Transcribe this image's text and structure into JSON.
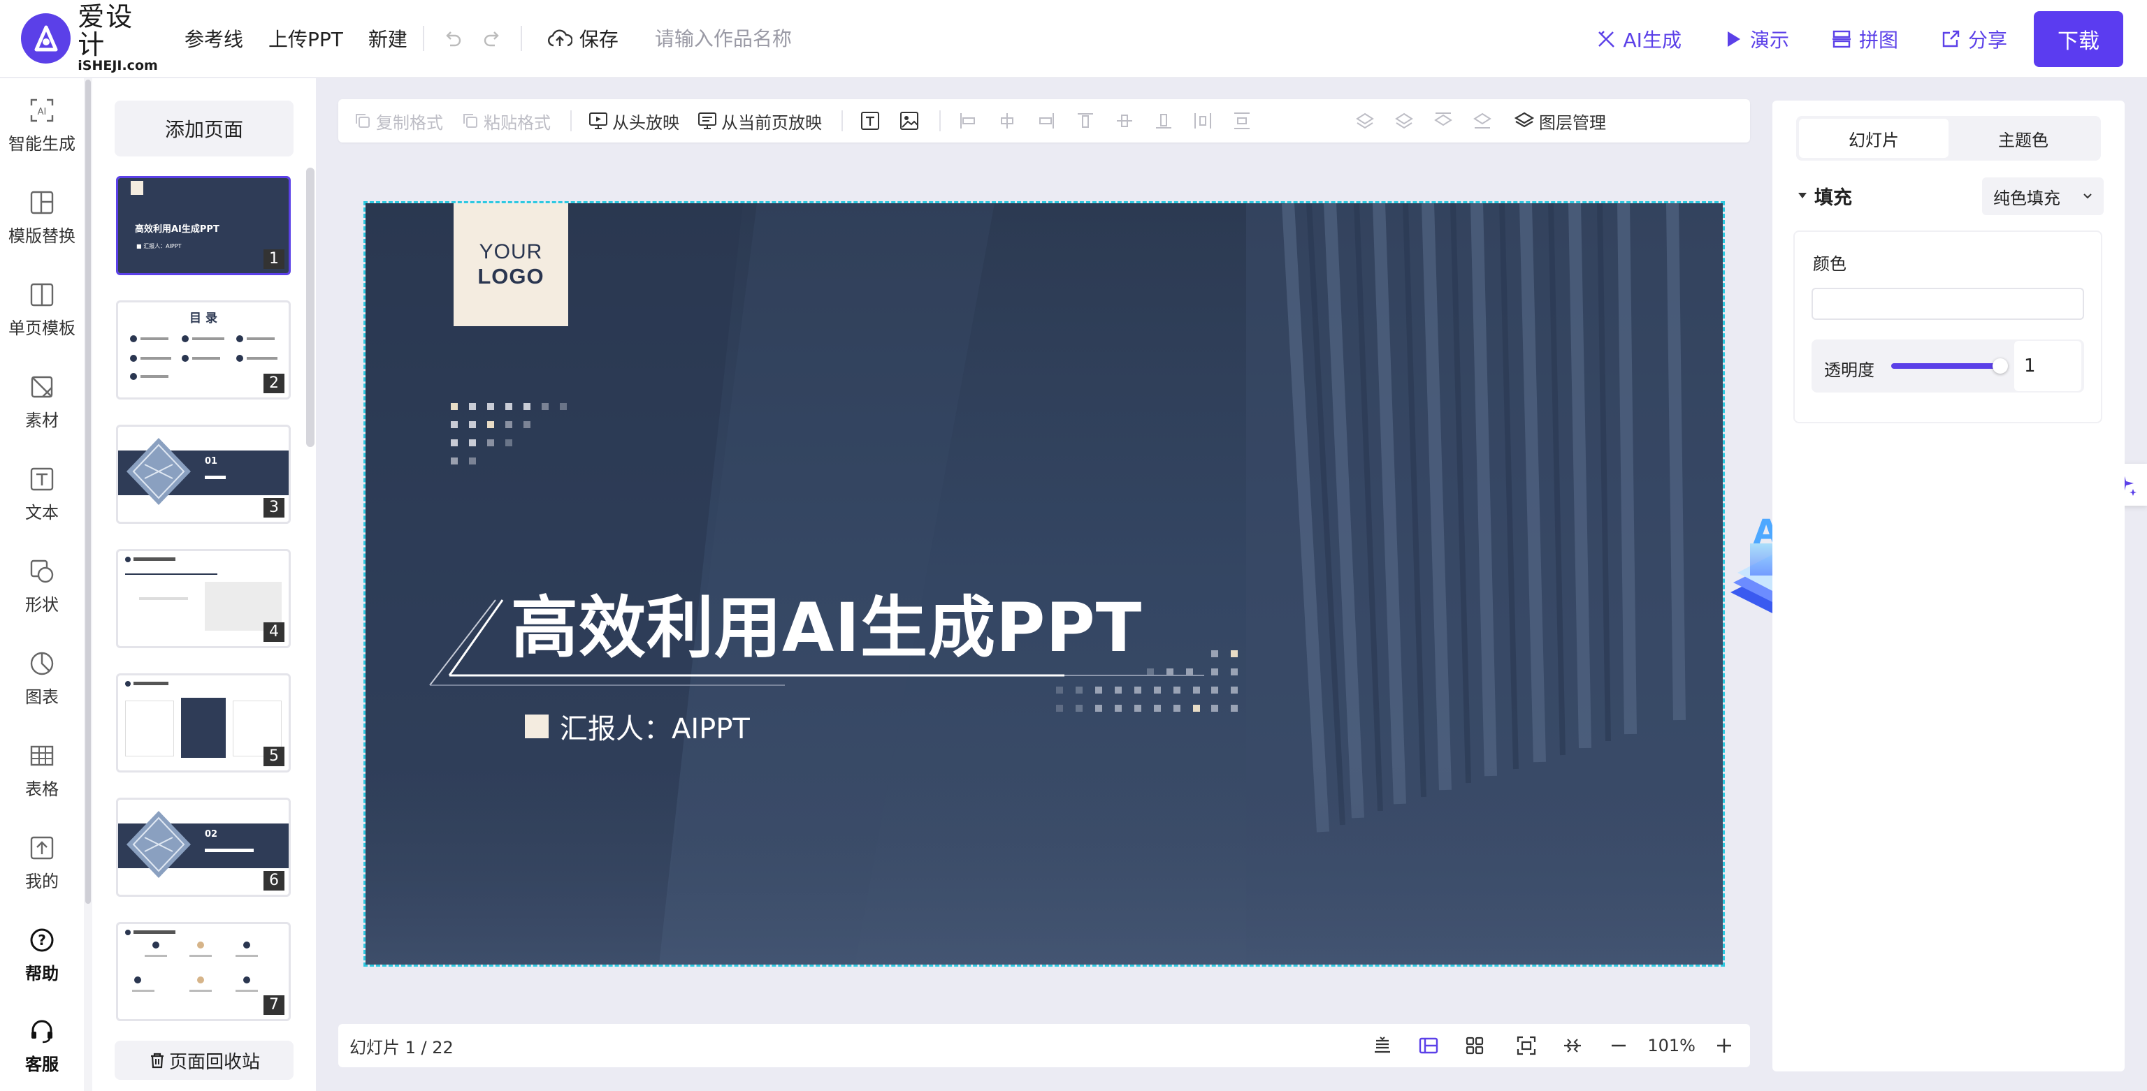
{
  "header": {
    "logo_cn": "爱设计",
    "logo_en": "iSHEJI.com",
    "menu": [
      "参考线",
      "上传PPT",
      "新建"
    ],
    "save_label": "保存",
    "title_placeholder": "请输入作品名称",
    "actions": {
      "ai_generate": "AI生成",
      "present": "演示",
      "collage": "拼图",
      "share": "分享"
    },
    "download_label": "下载",
    "accent_color": "#5b40e8"
  },
  "left_tools": [
    {
      "label": "智能生成",
      "icon": "ai-generate-icon"
    },
    {
      "label": "模版替换",
      "icon": "template-replace-icon"
    },
    {
      "label": "单页模板",
      "icon": "single-page-template-icon"
    },
    {
      "label": "素材",
      "icon": "material-icon"
    },
    {
      "label": "文本",
      "icon": "text-icon"
    },
    {
      "label": "形状",
      "icon": "shape-icon"
    },
    {
      "label": "图表",
      "icon": "chart-icon"
    },
    {
      "label": "表格",
      "icon": "table-icon"
    },
    {
      "label": "我的",
      "icon": "upload-icon"
    },
    {
      "label": "帮助",
      "icon": "help-icon"
    },
    {
      "label": "客服",
      "icon": "headset-icon"
    }
  ],
  "pages": {
    "add_label": "添加页面",
    "recycle_label": "页面回收站",
    "thumbs": [
      {
        "num": "1",
        "title": "高效利用AI生成PPT",
        "sub": "■ 汇报人：AIPPT"
      },
      {
        "num": "2",
        "title": "目 录"
      },
      {
        "num": "3",
        "title": "01"
      },
      {
        "num": "4"
      },
      {
        "num": "5"
      },
      {
        "num": "6",
        "title": "02"
      },
      {
        "num": "7"
      }
    ]
  },
  "editor_toolbar": {
    "copy_format": "复制格式",
    "paste_format": "粘贴格式",
    "play_from_start": "从头放映",
    "play_from_current": "从当前页放映",
    "layer_manage": "图层管理"
  },
  "slide": {
    "logo_line1": "YOUR",
    "logo_line2": "LOGO",
    "title": "高效利用AI生成PPT",
    "reporter": "汇报人：AIPPT",
    "bg_color": "#344663",
    "accent_cream": "#f4ece0"
  },
  "ai_float_label": "AI",
  "status": {
    "slide_counter": "幻灯片 1 / 22",
    "zoom": "101%"
  },
  "right_panel": {
    "tabs": [
      "幻灯片",
      "主题色"
    ],
    "fill_label": "填充",
    "fill_type": "纯色填充",
    "color_label": "颜色",
    "opacity_label": "透明度",
    "opacity_value": "1",
    "opacity_fraction": 0.95
  }
}
